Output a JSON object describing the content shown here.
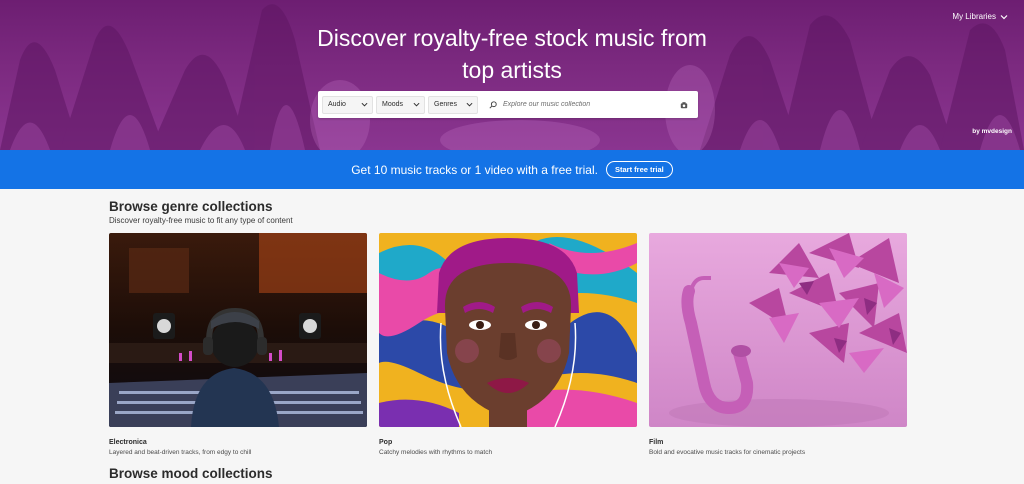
{
  "hero": {
    "title": "Discover royalty-free stock music from top artists",
    "libraries_label": "My Libraries",
    "credit": "by mvdesign"
  },
  "search": {
    "type_value": "Audio",
    "moods_value": "Moods",
    "genres_value": "Genres",
    "placeholder": "Explore our music collection"
  },
  "banner": {
    "text": "Get 10 music tracks or 1 video with a free trial.",
    "button_label": "Start free trial"
  },
  "genres": {
    "title": "Browse genre collections",
    "subtitle": "Discover royalty-free music to fit any type of content",
    "cards": [
      {
        "title": "Electronica",
        "description": "Layered and beat-driven tracks, from edgy to chill"
      },
      {
        "title": "Pop",
        "description": "Catchy melodies with rhythms to match"
      },
      {
        "title": "Film",
        "description": "Bold and evocative music tracks for cinematic projects"
      }
    ]
  },
  "moods": {
    "title": "Browse mood collections"
  },
  "colors": {
    "hero_purple": "#7c2a80",
    "banner_blue": "#1473e6",
    "film_pink": "#d88bd0"
  }
}
